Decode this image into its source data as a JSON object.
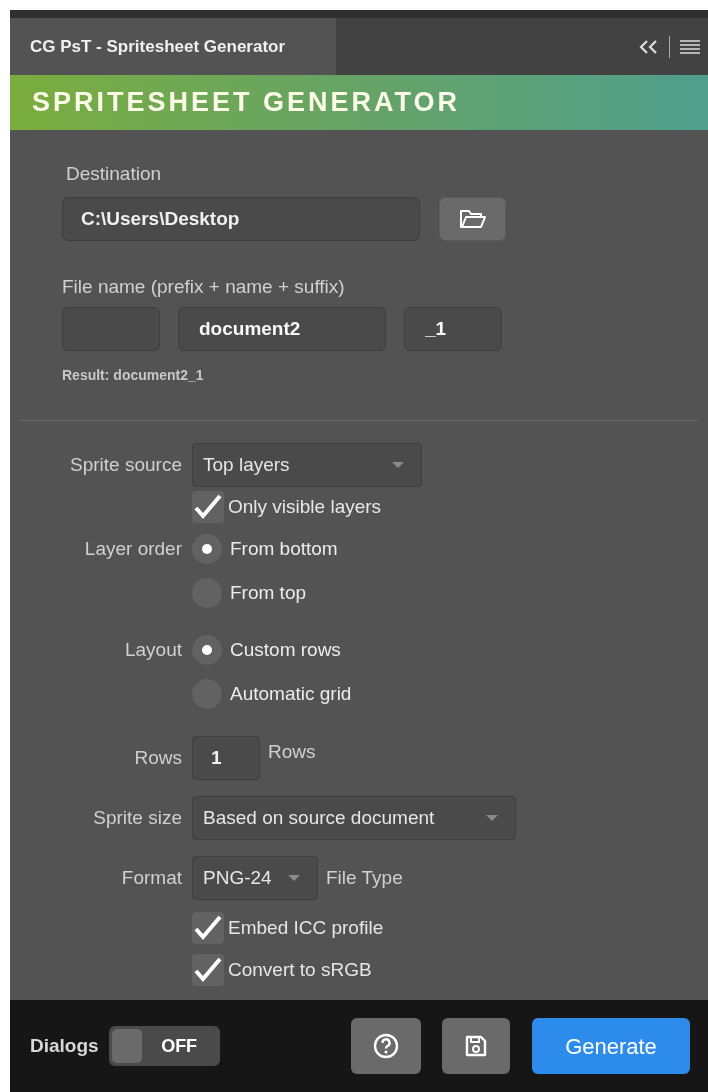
{
  "tab": {
    "label": "CG PsT - Spritesheet Generator"
  },
  "banner": {
    "title": "SPRITESHEET GENERATOR"
  },
  "destination": {
    "label": "Destination",
    "value": "C:\\Users\\Desktop"
  },
  "file_name": {
    "label": "File name (prefix + name + suffix)",
    "fields": [
      {
        "kind": "prefix"
      },
      {
        "kind": "name",
        "value": "document2"
      },
      {
        "kind": "suffix",
        "value": "_1"
      }
    ],
    "result": "Result: document2_1"
  },
  "sprite_source": {
    "label": "Sprite source",
    "value": "Top layers"
  },
  "only_visible": {
    "label": "Only visible layers",
    "checked": true
  },
  "layer_order": {
    "label": "Layer order",
    "options": [
      {
        "label": "From bottom",
        "selected": true
      },
      {
        "label": "From top",
        "selected": false
      }
    ]
  },
  "layout": {
    "label": "Layout",
    "options": [
      {
        "label": "Custom rows",
        "selected": true
      },
      {
        "label": "Automatic grid",
        "selected": false
      }
    ]
  },
  "rows": {
    "label": "Rows",
    "value": "1",
    "unit": "Rows"
  },
  "sprite_size": {
    "label": "Sprite size",
    "value": "Based on source document"
  },
  "format": {
    "label": "Format",
    "value": "PNG-24",
    "suffix": "File Type"
  },
  "format_options": [
    {
      "label": "Embed ICC profile",
      "checked": true
    },
    {
      "label": "Convert to sRGB",
      "checked": true
    }
  ],
  "footer": {
    "dialogs_label": "Dialogs",
    "dialogs_toggle": {
      "on": false,
      "label": "OFF"
    },
    "generate": "Generate"
  }
}
